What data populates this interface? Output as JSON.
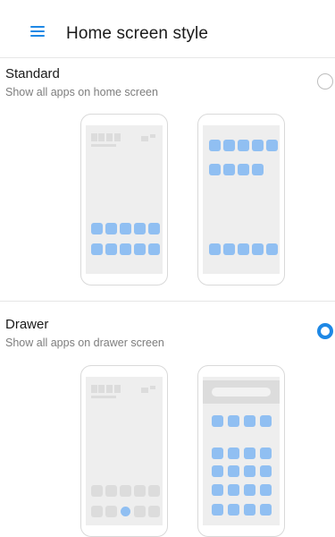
{
  "header": {
    "title": "Home screen style",
    "menu_icon": "hamburger-menu-icon",
    "accent_color": "#1e88e5"
  },
  "options": [
    {
      "title": "Standard",
      "subtitle": "Show all apps on home screen",
      "selected": false
    },
    {
      "title": "Drawer",
      "subtitle": "Show all apps on drawer screen",
      "selected": true
    }
  ]
}
